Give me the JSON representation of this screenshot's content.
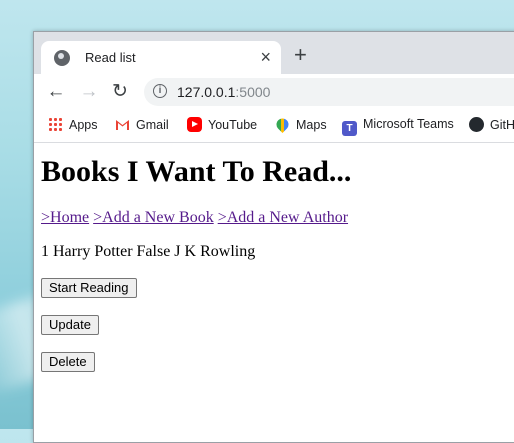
{
  "browser": {
    "tab_title": "Read list",
    "close_glyph": "×",
    "newtab_glyph": "+",
    "back_glyph": "←",
    "forward_glyph": "→",
    "reload_glyph": "↻",
    "url_host": "127.0.0.1",
    "url_port": ":5000",
    "info_glyph": "i",
    "bookmarks": [
      {
        "label": "Apps",
        "icon": "apps-grid-icon"
      },
      {
        "label": "Gmail",
        "icon": "gmail-icon"
      },
      {
        "label": "YouTube",
        "icon": "youtube-icon"
      },
      {
        "label": "Maps",
        "icon": "maps-icon"
      },
      {
        "label": "Microsoft Teams",
        "icon": "teams-icon"
      },
      {
        "label": "GitH",
        "icon": "github-icon"
      }
    ]
  },
  "page": {
    "heading": "Books I Want To Read...",
    "links": [
      ">Home",
      ">Add a New Book",
      ">Add a New Author"
    ],
    "record_text": "1 Harry Potter False J K Rowling",
    "buttons": {
      "start": "Start Reading",
      "update": "Update",
      "delete": "Delete"
    }
  },
  "colors": {
    "link_visited": "#551a8b",
    "tabstrip": "#dee1e6",
    "youtube_red": "#ff0000",
    "gmail_red": "#ea4335"
  }
}
